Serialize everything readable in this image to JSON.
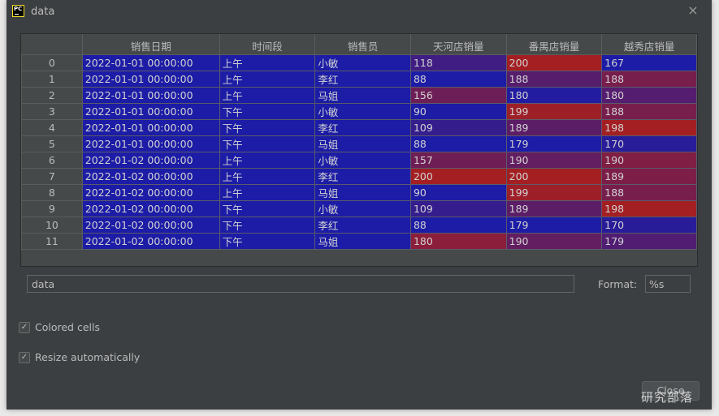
{
  "window": {
    "title": "data",
    "app_icon_text": "PC",
    "close_icon": "×"
  },
  "grid": {
    "columns": [
      "",
      "销售日期",
      "时间段",
      "销售员",
      "天河店销量",
      "番禺店销量",
      "越秀店销量"
    ],
    "rows": [
      {
        "index": "0",
        "date": "2022-01-01 00:00:00",
        "period": "上午",
        "seller": "小敏",
        "tianhe": 118,
        "panyu": 200,
        "yuexiu": 167
      },
      {
        "index": "1",
        "date": "2022-01-01 00:00:00",
        "period": "上午",
        "seller": "李红",
        "tianhe": 88,
        "panyu": 188,
        "yuexiu": 188
      },
      {
        "index": "2",
        "date": "2022-01-01 00:00:00",
        "period": "上午",
        "seller": "马姐",
        "tianhe": 156,
        "panyu": 180,
        "yuexiu": 180
      },
      {
        "index": "3",
        "date": "2022-01-01 00:00:00",
        "period": "下午",
        "seller": "小敏",
        "tianhe": 90,
        "panyu": 199,
        "yuexiu": 188
      },
      {
        "index": "4",
        "date": "2022-01-01 00:00:00",
        "period": "下午",
        "seller": "李红",
        "tianhe": 109,
        "panyu": 189,
        "yuexiu": 198
      },
      {
        "index": "5",
        "date": "2022-01-01 00:00:00",
        "period": "下午",
        "seller": "马姐",
        "tianhe": 88,
        "panyu": 179,
        "yuexiu": 170
      },
      {
        "index": "6",
        "date": "2022-01-02 00:00:00",
        "period": "上午",
        "seller": "小敏",
        "tianhe": 157,
        "panyu": 190,
        "yuexiu": 190
      },
      {
        "index": "7",
        "date": "2022-01-02 00:00:00",
        "period": "上午",
        "seller": "李红",
        "tianhe": 200,
        "panyu": 200,
        "yuexiu": 189
      },
      {
        "index": "8",
        "date": "2022-01-02 00:00:00",
        "period": "上午",
        "seller": "马姐",
        "tianhe": 90,
        "panyu": 199,
        "yuexiu": 188
      },
      {
        "index": "9",
        "date": "2022-01-02 00:00:00",
        "period": "下午",
        "seller": "小敏",
        "tianhe": 109,
        "panyu": 189,
        "yuexiu": 198
      },
      {
        "index": "10",
        "date": "2022-01-02 00:00:00",
        "period": "下午",
        "seller": "李红",
        "tianhe": 88,
        "panyu": 179,
        "yuexiu": 170
      },
      {
        "index": "11",
        "date": "2022-01-02 00:00:00",
        "period": "下午",
        "seller": "马姐",
        "tianhe": 180,
        "panyu": 190,
        "yuexiu": 179
      }
    ],
    "colors": {
      "low": "#1c1ca6",
      "high": "#a31f22"
    }
  },
  "controls": {
    "name_value": "data",
    "format_label": "Format:",
    "format_value": "%s",
    "colored_cells_label": "Colored cells",
    "colored_cells_checked": true,
    "resize_label": "Resize automatically",
    "resize_checked": true,
    "close_label": "Close",
    "check_glyph": "✓"
  },
  "watermark": "研究部落"
}
